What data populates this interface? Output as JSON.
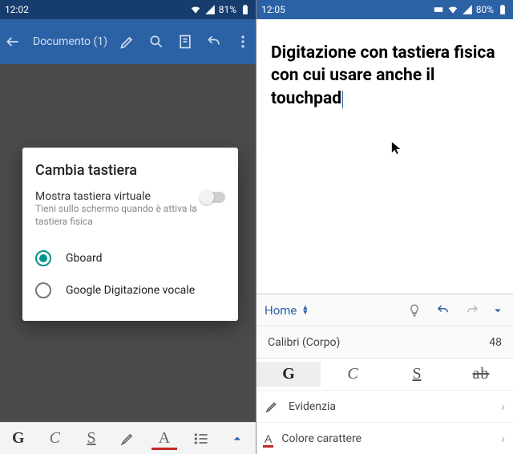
{
  "left": {
    "status": {
      "time": "12:02",
      "battery": "81%"
    },
    "appbar": {
      "title": "Documento (1)"
    },
    "dialog": {
      "title": "Cambia tastiera",
      "vkbd_title": "Mostra tastiera virtuale",
      "vkbd_sub": "Tieni sullo schermo quando è attiva la tastiera fisica",
      "options": [
        {
          "label": "Gboard",
          "selected": true
        },
        {
          "label": "Google Digitazione vocale",
          "selected": false
        }
      ]
    },
    "toolbar": {
      "bold": "G",
      "italic": "C",
      "underline": "S"
    }
  },
  "right": {
    "status": {
      "time": "12:05",
      "battery": "80%"
    },
    "document_text": "Digitazione con tastiera fisica con  cui usare anche il touchpad",
    "panel": {
      "home": "Home",
      "font_name": "Calibri (Corpo)",
      "font_size": "48",
      "format": {
        "bold": "G",
        "italic": "C",
        "underline": "S",
        "strike": "ab"
      },
      "highlight": "Evidenzia",
      "fontcolor": "Colore carattere"
    }
  }
}
